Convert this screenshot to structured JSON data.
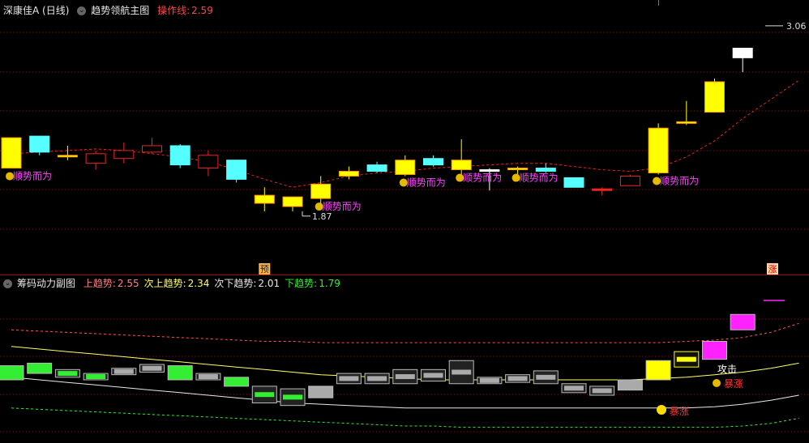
{
  "main_header": {
    "stock": "深康佳A (日线)",
    "indicator": "趋势领航主图",
    "op_label": "操作线:",
    "op_value": "2.59"
  },
  "sub_header": {
    "indicator": "筹码动力副图",
    "items": [
      {
        "label": "上趋势:",
        "value": "2.55",
        "color": "#ff8080"
      },
      {
        "label": "次上趋势:",
        "value": "2.34",
        "color": "#ffff66"
      },
      {
        "label": "次下趋势:",
        "value": "2.01",
        "color": "#e8e8e8"
      },
      {
        "label": "下趋势:",
        "value": "1.79",
        "color": "#33ee33"
      }
    ]
  },
  "chart_data": [
    {
      "type": "candlestick",
      "title": "趋势领航主图",
      "ylim": [
        1.55,
        3.12
      ],
      "max_label": "3.06",
      "min_label": "1.87",
      "candles": [
        {
          "o": 2.36,
          "h": 2.36,
          "l": 2.17,
          "c": 2.17,
          "color": "#ffff00"
        },
        {
          "o": 2.37,
          "h": 2.37,
          "l": 2.25,
          "c": 2.27,
          "color": "#55ffff"
        },
        {
          "o": 2.25,
          "h": 2.31,
          "l": 2.22,
          "c": 2.24,
          "color": "#ffff00"
        },
        {
          "o": 2.2,
          "h": 2.28,
          "l": 2.16,
          "c": 2.26,
          "color": "#ee2222",
          "hollow": true
        },
        {
          "o": 2.23,
          "h": 2.33,
          "l": 2.2,
          "c": 2.28,
          "color": "#ee2222",
          "hollow": true
        },
        {
          "o": 2.27,
          "h": 2.36,
          "l": 2.26,
          "c": 2.31,
          "color": "#ee2222",
          "hollow": true
        },
        {
          "o": 2.31,
          "h": 2.32,
          "l": 2.17,
          "c": 2.19,
          "color": "#55ffff"
        },
        {
          "o": 2.17,
          "h": 2.28,
          "l": 2.12,
          "c": 2.25,
          "color": "#ee2222",
          "hollow": true
        },
        {
          "o": 2.22,
          "h": 2.22,
          "l": 2.08,
          "c": 2.1,
          "color": "#55ffff"
        },
        {
          "o": 2.0,
          "h": 2.05,
          "l": 1.9,
          "c": 1.95,
          "color": "#ffff00"
        },
        {
          "o": 1.99,
          "h": 1.99,
          "l": 1.9,
          "c": 1.93,
          "color": "#ffff00"
        },
        {
          "o": 1.98,
          "h": 2.12,
          "l": 1.93,
          "c": 2.07,
          "color": "#ffff00"
        },
        {
          "o": 2.12,
          "h": 2.18,
          "l": 2.1,
          "c": 2.15,
          "color": "#ffff00"
        },
        {
          "o": 2.19,
          "h": 2.21,
          "l": 2.14,
          "c": 2.15,
          "color": "#55ffff"
        },
        {
          "o": 2.13,
          "h": 2.25,
          "l": 2.12,
          "c": 2.22,
          "color": "#ffff00"
        },
        {
          "o": 2.23,
          "h": 2.25,
          "l": 2.18,
          "c": 2.19,
          "color": "#55ffff"
        },
        {
          "o": 2.16,
          "h": 2.35,
          "l": 2.12,
          "c": 2.22,
          "color": "#ffff00"
        },
        {
          "o": 2.16,
          "h": 2.17,
          "l": 2.03,
          "c": 2.16,
          "color": "#ffffff"
        },
        {
          "o": 2.16,
          "h": 2.18,
          "l": 2.12,
          "c": 2.17,
          "color": "#ffff00"
        },
        {
          "o": 2.17,
          "h": 2.2,
          "l": 2.14,
          "c": 2.15,
          "color": "#55ffff"
        },
        {
          "o": 2.11,
          "h": 2.11,
          "l": 2.06,
          "c": 2.05,
          "color": "#55ffff"
        },
        {
          "o": 2.04,
          "h": 2.05,
          "l": 2.0,
          "c": 2.04,
          "color": "#ee2222"
        },
        {
          "o": 2.06,
          "h": 2.13,
          "l": 2.06,
          "c": 2.12,
          "color": "#ee2222",
          "hollow": true
        },
        {
          "o": 2.14,
          "h": 2.45,
          "l": 2.13,
          "c": 2.42,
          "color": "#ffff00"
        },
        {
          "o": 2.45,
          "h": 2.59,
          "l": 2.44,
          "c": 2.46,
          "color": "#ffff00"
        },
        {
          "o": 2.52,
          "h": 2.73,
          "l": 2.52,
          "c": 2.71,
          "color": "#ffff00"
        },
        {
          "o": 2.86,
          "h": 2.92,
          "l": 2.77,
          "c": 2.92,
          "color": "#ffffff"
        }
      ],
      "trend_line": [
        2.26,
        2.27,
        2.28,
        2.29,
        2.28,
        2.26,
        2.24,
        2.21,
        2.16,
        2.1,
        2.05,
        2.08,
        2.12,
        2.14,
        2.15,
        2.17,
        2.18,
        2.19,
        2.2,
        2.2,
        2.18,
        2.16,
        2.15,
        2.17,
        2.24,
        2.34,
        2.48,
        2.6,
        2.72
      ],
      "markers": [
        {
          "bar": 0,
          "text": "顺势而为"
        },
        {
          "bar": 11,
          "text": "顺势而为"
        },
        {
          "bar": 14,
          "text": "顺势而为"
        },
        {
          "bar": 16,
          "text": "顺势而为"
        },
        {
          "bar": 18,
          "text": "顺势而为"
        },
        {
          "bar": 23,
          "text": "顺势而为"
        }
      ],
      "yu_label": "预",
      "zhang_label": "涨"
    },
    {
      "type": "bands",
      "title": "筹码动力副图",
      "ylim": [
        1.6,
        2.8
      ],
      "bands": [
        {
          "name": "上趋势",
          "color": "#ff5555",
          "dashed": true,
          "values": [
            2.47,
            2.46,
            2.45,
            2.44,
            2.43,
            2.42,
            2.41,
            2.4,
            2.39,
            2.38,
            2.38,
            2.37,
            2.37,
            2.37,
            2.37,
            2.37,
            2.37,
            2.37,
            2.37,
            2.37,
            2.37,
            2.37,
            2.37,
            2.37,
            2.38,
            2.39,
            2.41,
            2.45,
            2.52
          ]
        },
        {
          "name": "次上趋势",
          "color": "#ffff66",
          "dashed": false,
          "values": [
            2.34,
            2.32,
            2.3,
            2.28,
            2.26,
            2.24,
            2.22,
            2.2,
            2.18,
            2.16,
            2.14,
            2.12,
            2.11,
            2.1,
            2.09,
            2.08,
            2.08,
            2.08,
            2.08,
            2.08,
            2.08,
            2.08,
            2.08,
            2.09,
            2.1,
            2.12,
            2.14,
            2.17,
            2.21
          ]
        },
        {
          "name": "次下趋势",
          "color": "#e8e8e8",
          "dashed": false,
          "values": [
            2.1,
            2.08,
            2.06,
            2.04,
            2.02,
            2.0,
            1.98,
            1.96,
            1.94,
            1.92,
            1.9,
            1.89,
            1.88,
            1.87,
            1.86,
            1.86,
            1.86,
            1.86,
            1.86,
            1.86,
            1.86,
            1.86,
            1.86,
            1.86,
            1.86,
            1.87,
            1.89,
            1.92,
            1.96
          ]
        },
        {
          "name": "下趋势",
          "color": "#33ee33",
          "dashed": true,
          "values": [
            1.86,
            1.85,
            1.84,
            1.83,
            1.82,
            1.81,
            1.8,
            1.79,
            1.78,
            1.77,
            1.76,
            1.75,
            1.74,
            1.73,
            1.72,
            1.72,
            1.71,
            1.71,
            1.71,
            1.71,
            1.71,
            1.71,
            1.71,
            1.71,
            1.71,
            1.71,
            1.72,
            1.74,
            1.78
          ]
        }
      ],
      "boxes": [
        {
          "lo": 2.08,
          "hi": 2.19,
          "fill": "#33ee33",
          "inner": false
        },
        {
          "lo": 2.13,
          "hi": 2.21,
          "fill": "#33ee33",
          "inner": false
        },
        {
          "lo": 2.1,
          "hi": 2.16,
          "fill": "#222222",
          "inner": "#33ee33"
        },
        {
          "lo": 2.08,
          "hi": 2.13,
          "fill": "#222222",
          "inner": "#33ee33"
        },
        {
          "lo": 2.12,
          "hi": 2.17,
          "fill": "#222222",
          "inner": "#aaaaaa"
        },
        {
          "lo": 2.14,
          "hi": 2.2,
          "fill": "#222222",
          "inner": "#aaaaaa"
        },
        {
          "lo": 2.08,
          "hi": 2.19,
          "fill": "#33ee33",
          "inner": false
        },
        {
          "lo": 2.08,
          "hi": 2.13,
          "fill": "#222222",
          "inner": "#aaaaaa"
        },
        {
          "lo": 2.03,
          "hi": 2.1,
          "fill": "#33ee33",
          "inner": false
        },
        {
          "lo": 1.9,
          "hi": 2.03,
          "fill": "#222222",
          "inner": "#33ee33"
        },
        {
          "lo": 1.88,
          "hi": 2.01,
          "fill": "#222222",
          "inner": "#33ee33"
        },
        {
          "lo": 1.94,
          "hi": 2.03,
          "fill": "#aaaaaa",
          "inner": false
        },
        {
          "lo": 2.05,
          "hi": 2.13,
          "fill": "#222222",
          "inner": "#aaaaaa"
        },
        {
          "lo": 2.05,
          "hi": 2.13,
          "fill": "#222222",
          "inner": "#aaaaaa"
        },
        {
          "lo": 2.05,
          "hi": 2.16,
          "fill": "#222222",
          "inner": "#aaaaaa"
        },
        {
          "lo": 2.07,
          "hi": 2.16,
          "fill": "#222222",
          "inner": "#aaaaaa"
        },
        {
          "lo": 2.05,
          "hi": 2.23,
          "fill": "#222222",
          "inner": "#aaaaaa"
        },
        {
          "lo": 2.05,
          "hi": 2.1,
          "fill": "#222222",
          "inner": "#aaaaaa"
        },
        {
          "lo": 2.06,
          "hi": 2.12,
          "fill": "#222222",
          "inner": "#aaaaaa"
        },
        {
          "lo": 2.05,
          "hi": 2.15,
          "fill": "#222222",
          "inner": "#aaaaaa"
        },
        {
          "lo": 1.98,
          "hi": 2.05,
          "fill": "#222222",
          "inner": "#aaaaaa"
        },
        {
          "lo": 1.96,
          "hi": 2.03,
          "fill": "#222222",
          "inner": "#aaaaaa"
        },
        {
          "lo": 2.0,
          "hi": 2.08,
          "fill": "#aaaaaa",
          "inner": false
        },
        {
          "lo": 2.08,
          "hi": 2.23,
          "fill": "#ffff00",
          "inner": false
        },
        {
          "lo": 2.18,
          "hi": 2.3,
          "fill": "#111111",
          "inner": "#ffff00"
        },
        {
          "lo": 2.24,
          "hi": 2.38,
          "fill": "#ff22ff",
          "inner": false
        },
        {
          "lo": 2.47,
          "hi": 2.59,
          "fill": "#ff22ff",
          "inner": false
        }
      ],
      "attack_label": "攻击",
      "surge_labels": [
        "暴涨",
        "暴涨"
      ]
    }
  ]
}
